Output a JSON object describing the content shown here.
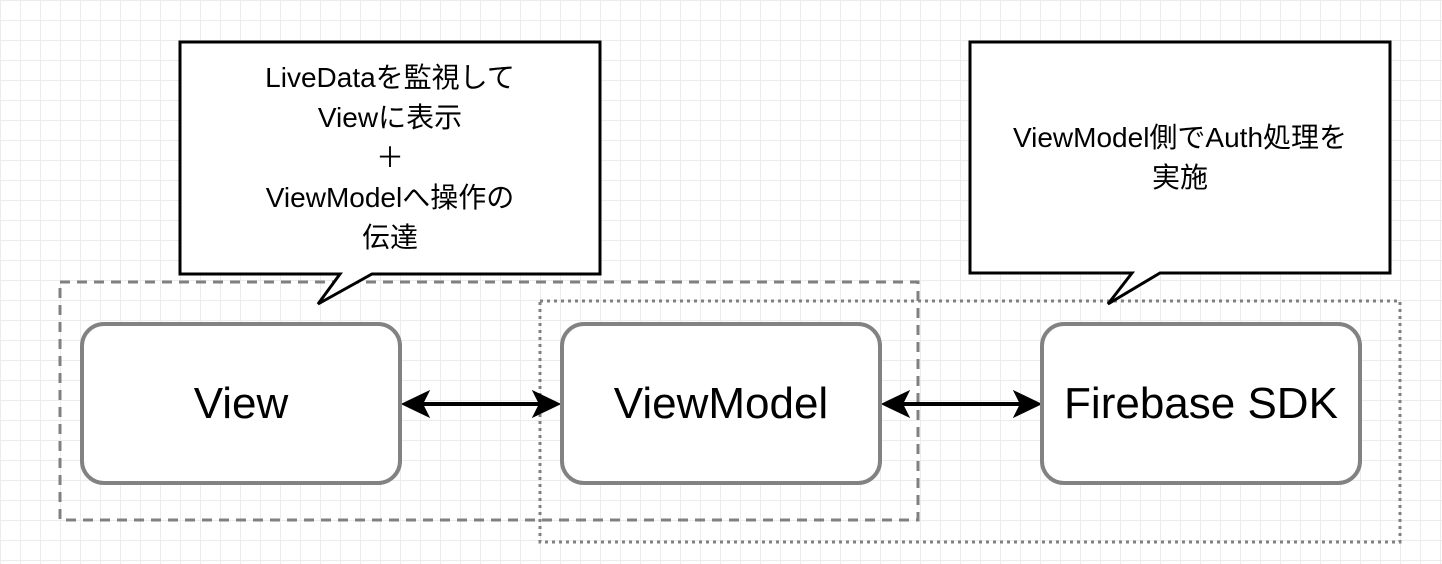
{
  "diagram": {
    "nodes": [
      {
        "id": "view",
        "label": "View"
      },
      {
        "id": "viewmodel",
        "label": "ViewModel"
      },
      {
        "id": "firebase",
        "label": "Firebase SDK"
      }
    ],
    "edges": [
      {
        "from": "view",
        "to": "viewmodel",
        "direction": "both"
      },
      {
        "from": "viewmodel",
        "to": "firebase",
        "direction": "both"
      }
    ],
    "callouts": [
      {
        "id": "view-callout",
        "lines": [
          "LiveDataを監視して",
          "Viewに表示",
          "＋",
          "ViewModelへ操作の",
          "伝達"
        ]
      },
      {
        "id": "viewmodel-callout",
        "lines": [
          "ViewModel側でAuth処理を",
          "実施"
        ]
      }
    ],
    "groups": [
      {
        "id": "view-layer-group",
        "style": "dashed"
      },
      {
        "id": "viewmodel-layer-group",
        "style": "dotted"
      }
    ]
  },
  "colors": {
    "node_border": "#828282",
    "group_border": "#808080",
    "arrow": "#000000",
    "callout_border": "#000000",
    "grid": "#ececec"
  }
}
